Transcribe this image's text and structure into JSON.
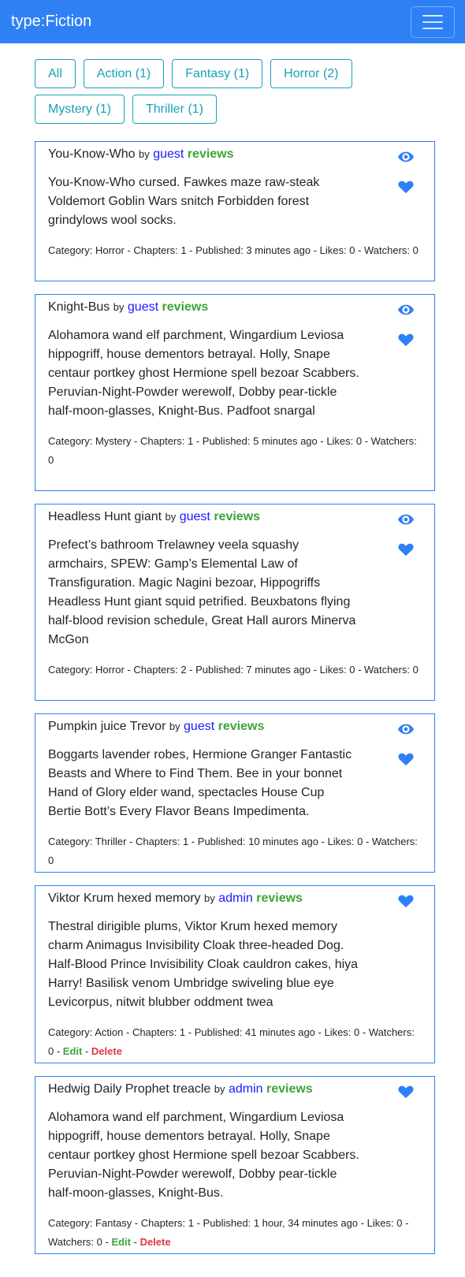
{
  "navbar": {
    "brand": "type:Fiction"
  },
  "filters": [
    "All",
    "Action (1)",
    "Fantasy (1)",
    "Horror (2)",
    "Mystery (1)",
    "Thriller (1)"
  ],
  "stories": [
    {
      "title": "You-Know-Who",
      "by": "by",
      "author": "guest",
      "reviews": "reviews",
      "body": "You-Know-Who cursed. Fawkes maze raw-steak Voldemort Goblin Wars snitch Forbidden forest grindylows wool socks.",
      "meta": "Category: Horror - Chapters: 1 - Published: 3 minutes ago - Likes: 0 - Watchers: 0",
      "watch_icon": "eye-icon",
      "like_icon": "heart-icon"
    },
    {
      "title": "Knight-Bus",
      "by": "by",
      "author": "guest",
      "reviews": "reviews",
      "body": "Alohamora wand elf parchment, Wingardium Leviosa hippogriff, house dementors betrayal. Holly, Snape centaur portkey ghost Hermione spell bezoar Scabbers. Peruvian-Night-Powder werewolf, Dobby pear-tickle half-moon-glasses, Knight-Bus. Padfoot snargal",
      "meta": "Category: Mystery - Chapters: 1 - Published: 5 minutes ago - Likes: 0 - Watchers: 0",
      "watch_icon": "eye-icon",
      "like_icon": "heart-icon"
    },
    {
      "title": "Headless Hunt giant",
      "by": "by",
      "author": "guest",
      "reviews": "reviews",
      "body": "Prefect’s bathroom Trelawney veela squashy armchairs, SPEW: Gamp’s Elemental Law of Transfiguration. Magic Nagini bezoar, Hippogriffs Headless Hunt giant squid petrified. Beuxbatons flying half-blood revision schedule, Great Hall aurors Minerva McGon",
      "meta": "Category: Horror - Chapters: 2 - Published: 7 minutes ago - Likes: 0 - Watchers: 0",
      "watch_icon": "eye-icon",
      "like_icon": "heart-icon"
    },
    {
      "title": "Pumpkin juice Trevor",
      "by": "by",
      "author": "guest",
      "reviews": "reviews",
      "body": "Boggarts lavender robes, Hermione Granger Fantastic Beasts and Where to Find Them. Bee in your bonnet Hand of Glory elder wand, spectacles House Cup Bertie Bott’s Every Flavor Beans Impedimenta.",
      "meta": "Category: Thriller - Chapters: 1 - Published: 10 minutes ago - Likes: 0 - Watchers: 0",
      "watch_icon": "eye-icon",
      "like_icon": "heart-icon"
    },
    {
      "title": "Viktor Krum hexed memory",
      "by": "by",
      "author": "admin",
      "reviews": "reviews",
      "body": "Thestral dirigible plums, Viktor Krum hexed memory charm Animagus Invisibility Cloak three-headed Dog. Half-Blood Prince Invisibility Cloak cauldron cakes, hiya Harry! Basilisk venom Umbridge swiveling blue eye Levicorpus, nitwit blubber oddment twea",
      "meta": "Category: Action - Chapters: 1 - Published: 41 minutes ago - Likes: 0 - Watchers: 0",
      "edit": "Edit",
      "delete": "Delete",
      "like_icon": "heart-icon"
    },
    {
      "title": "Hedwig Daily Prophet treacle",
      "by": "by",
      "author": "admin",
      "reviews": "reviews",
      "body": "Alohamora wand elf parchment, Wingardium Leviosa hippogriff, house dementors betrayal. Holly, Snape centaur portkey ghost Hermione spell bezoar Scabbers. Peruvian-Night-Powder werewolf, Dobby pear-tickle half-moon-glasses, Knight-Bus.",
      "meta": "Category: Fantasy - Chapters: 1 - Published: 1 hour, 34 minutes ago - Likes: 0 - Watchers: 0",
      "edit": "Edit",
      "delete": "Delete",
      "like_icon": "heart-icon"
    }
  ],
  "colors": {
    "navbar": "#2f80f5",
    "filter": "#17a2b8",
    "author": "#1a1aff",
    "reviews": "#3fa33a",
    "delete": "#dc3545",
    "icon": "#2f80f5"
  }
}
